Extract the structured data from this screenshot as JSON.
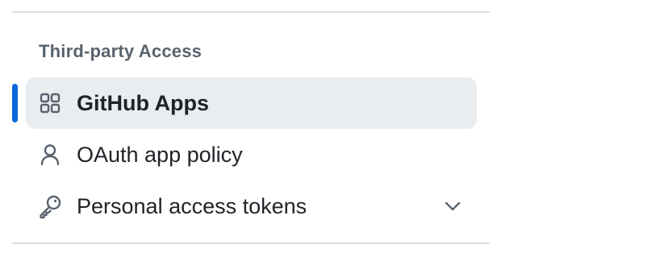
{
  "sidebar": {
    "section_heading": "Third-party Access",
    "items": [
      {
        "label": "GitHub Apps",
        "icon": "apps-icon",
        "selected": true
      },
      {
        "label": "OAuth app policy",
        "icon": "person-icon",
        "selected": false
      },
      {
        "label": "Personal access tokens",
        "icon": "key-icon",
        "selected": false,
        "expandable": true,
        "expand_icon": "chevron-down-icon"
      }
    ]
  },
  "colors": {
    "accent": "#0969da",
    "selected_background": "#eaedf0",
    "heading_text": "#59636e",
    "text": "#1f2328",
    "divider": "#d8dee4"
  }
}
